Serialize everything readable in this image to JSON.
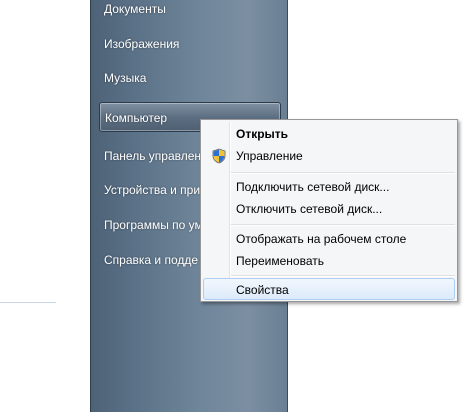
{
  "start_menu": {
    "items": [
      {
        "label": "Документы"
      },
      {
        "label": "Изображения"
      },
      {
        "label": "Музыка"
      },
      {
        "label": "Компьютер"
      },
      {
        "label": "Панель управлен"
      },
      {
        "label": "Устройства и при"
      },
      {
        "label": "Программы по ум"
      },
      {
        "label": "Справка и подде"
      }
    ]
  },
  "context_menu": {
    "items": [
      {
        "label": "Открыть"
      },
      {
        "label": "Управление",
        "icon": "uac-shield-icon"
      },
      {
        "label": "Подключить сетевой диск..."
      },
      {
        "label": "Отключить сетевой диск..."
      },
      {
        "label": "Отображать на рабочем столе"
      },
      {
        "label": "Переименовать"
      },
      {
        "label": "Свойства"
      }
    ]
  },
  "colors": {
    "panel": "#5b7187",
    "menu_bg": "#f5f6f7",
    "hover": "#dceafa"
  }
}
